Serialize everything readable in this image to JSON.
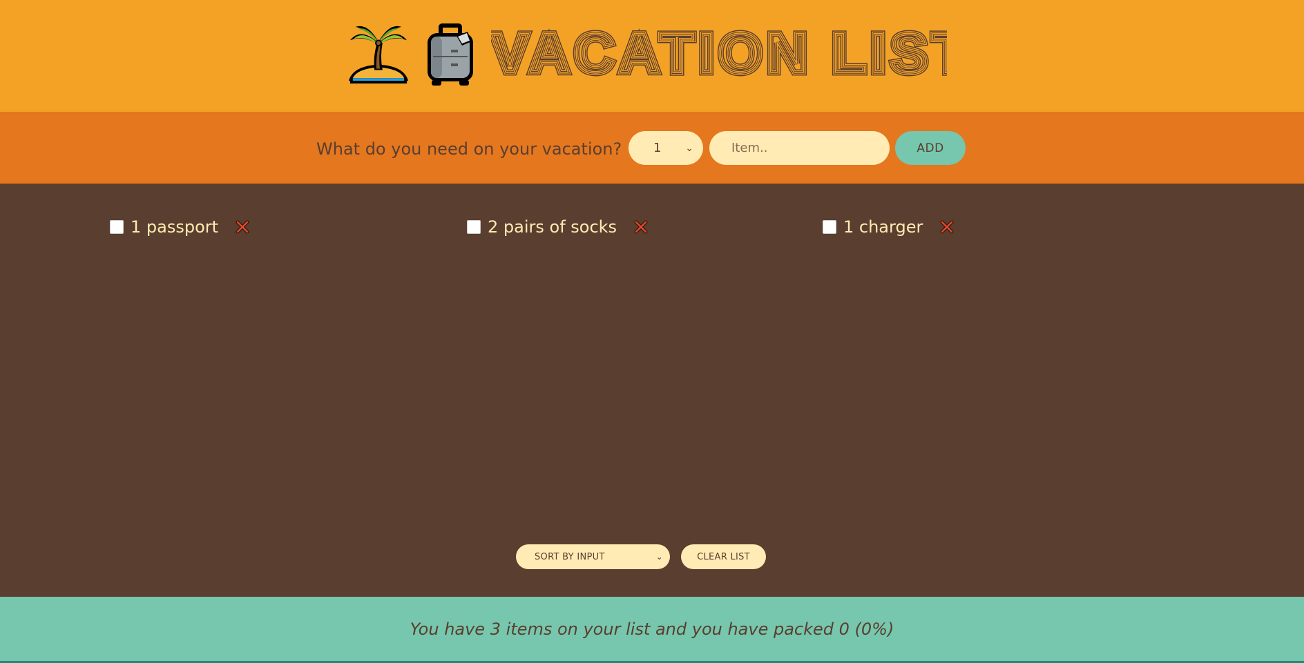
{
  "header": {
    "title": "VACATION LIST",
    "emoji_palm": "palm-tree-icon",
    "emoji_luggage": "luggage-icon"
  },
  "form": {
    "question": "What do you need on your vacation?",
    "quantity_value": "1",
    "item_placeholder": "Item..",
    "add_label": "ADD"
  },
  "items": [
    {
      "text": "1 passport",
      "packed": false
    },
    {
      "text": "2 pairs of socks",
      "packed": false
    },
    {
      "text": "1 charger",
      "packed": false
    }
  ],
  "actions": {
    "sort_value": "SORT BY INPUT",
    "clear_label": "CLEAR LIST"
  },
  "stats": {
    "text": "You have 3 items on your list and you have packed 0 (0%)"
  },
  "colors": {
    "header_bg": "#f4a226",
    "form_bg": "#e5771e",
    "list_bg": "#5a3e2f",
    "stats_bg": "#76c7ad",
    "cream": "#ffebb3",
    "brown": "#5a3e2f",
    "delete_red": "#e5472b"
  }
}
